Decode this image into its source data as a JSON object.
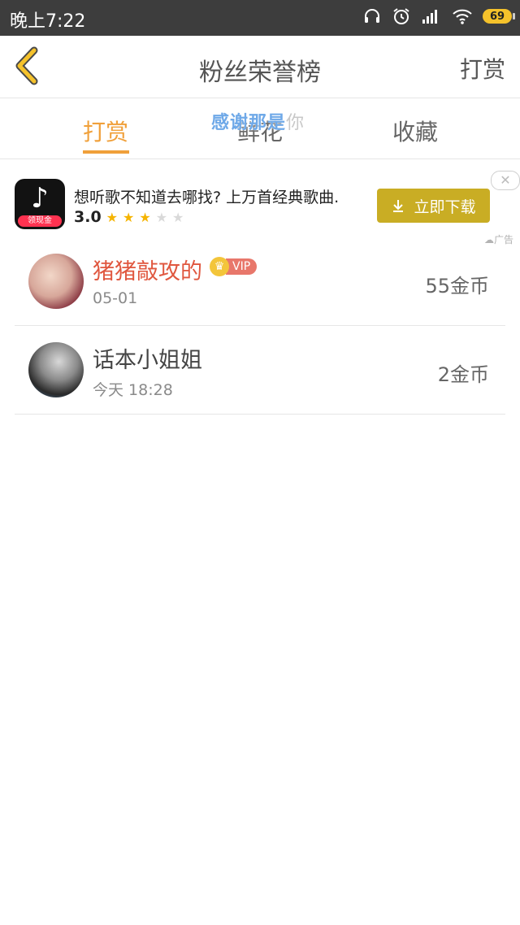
{
  "status_bar": {
    "time": "晚上7:22",
    "battery": "69",
    "icons": [
      "headphones-icon",
      "alarm-icon",
      "signal-icon",
      "wifi-icon",
      "battery-icon"
    ]
  },
  "header": {
    "title": "粉丝荣誉榜",
    "action": "打赏"
  },
  "tabs": [
    {
      "label": "打赏",
      "active": true
    },
    {
      "label": "鲜花",
      "active": false
    },
    {
      "label": "收藏",
      "active": false
    }
  ],
  "overlay": {
    "text": "感谢那是",
    "faded": "你"
  },
  "ad": {
    "badge": "领现金",
    "description": "想听歌不知道去哪找? 上万首经典歌曲.",
    "rating": "3.0",
    "stars_filled": 3,
    "stars_total": 5,
    "button": "立即下载",
    "tag": "广告"
  },
  "list": [
    {
      "name": "猪猪敲攻的",
      "vip": true,
      "vip_label": "VIP",
      "date": "05-01",
      "amount": "55金币"
    },
    {
      "name": "话本小姐姐",
      "vip": false,
      "date": "今天 18:28",
      "amount": "2金币"
    }
  ],
  "colors": {
    "accent": "#f0a03a",
    "status_bar": "#3d3d3d",
    "download": "#c9ad24",
    "vip_name": "#e0573f"
  }
}
